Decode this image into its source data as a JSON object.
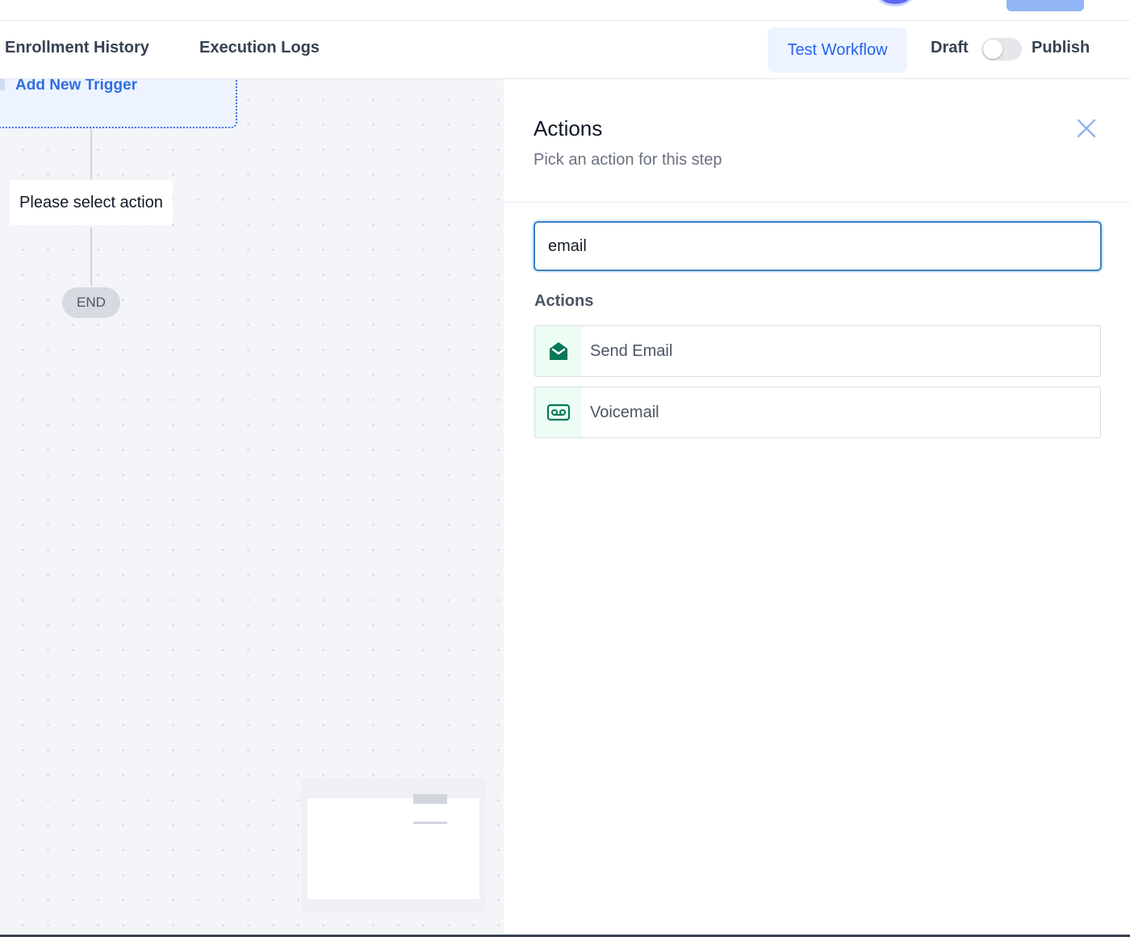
{
  "tabs": [
    {
      "label": "Enrollment History"
    },
    {
      "label": "Execution Logs"
    }
  ],
  "header": {
    "test_button": "Test Workflow",
    "draft_label": "Draft",
    "publish_label": "Publish",
    "published": false
  },
  "canvas": {
    "add_trigger": "Add New Trigger",
    "action_placeholder": "Please select action",
    "end_label": "END"
  },
  "panel": {
    "title": "Actions",
    "subtitle": "Pick an action for this step",
    "search_value": "email",
    "section_label": "Actions",
    "results": [
      {
        "label": "Send Email",
        "icon": "envelope-open-icon"
      },
      {
        "label": "Voicemail",
        "icon": "voicemail-icon"
      }
    ]
  },
  "colors": {
    "accent": "#2563eb",
    "icon_green": "#047857",
    "icon_bg": "#ecfdf3"
  }
}
